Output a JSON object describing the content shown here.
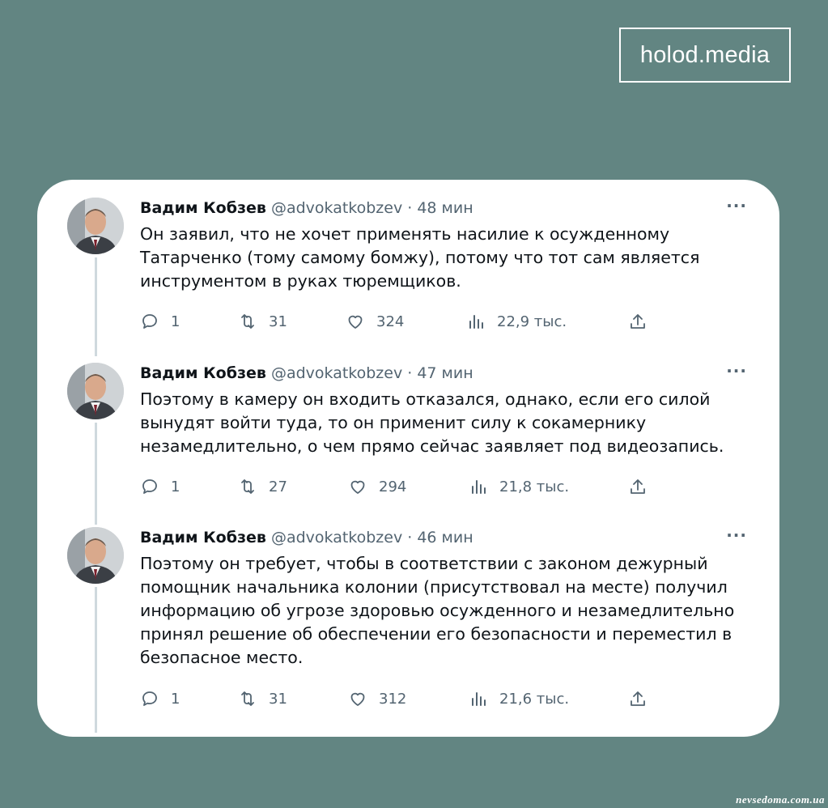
{
  "brand": {
    "label": "holod.media"
  },
  "tweets": [
    {
      "name": "Вадим Кобзев",
      "handle": "@advokatkobzev",
      "time": "· 48 мин",
      "text": "Он заявил, что не хочет применять насилие к осужденному Татарченко (тому самому бомжу), потому что тот сам является инструментом в руках тюремщиков.",
      "replies": "1",
      "retweets": "31",
      "likes": "324",
      "views": "22,9 тыс."
    },
    {
      "name": "Вадим Кобзев",
      "handle": "@advokatkobzev",
      "time": "· 47 мин",
      "text": "Поэтому в камеру он входить отказался, однако, если его силой вынудят войти туда, то он применит силу к сокамернику незамедлительно, о чем прямо сейчас заявляет под видеозапись.",
      "replies": "1",
      "retweets": "27",
      "likes": "294",
      "views": "21,8 тыс."
    },
    {
      "name": "Вадим Кобзев",
      "handle": "@advokatkobzev",
      "time": "· 46 мин",
      "text": "Поэтому он требует, чтобы в соответствии с законом дежурный помощник начальника колонии (присутствовал на месте) получил информацию об угрозе здоровью осужденного и незамедлительно принял решение об обеспечении его безопасности и переместил в безопасное место.",
      "replies": "1",
      "retweets": "31",
      "likes": "312",
      "views": "21,6 тыс."
    }
  ],
  "more_label": "···",
  "watermark": "nevsedoma.com.ua"
}
